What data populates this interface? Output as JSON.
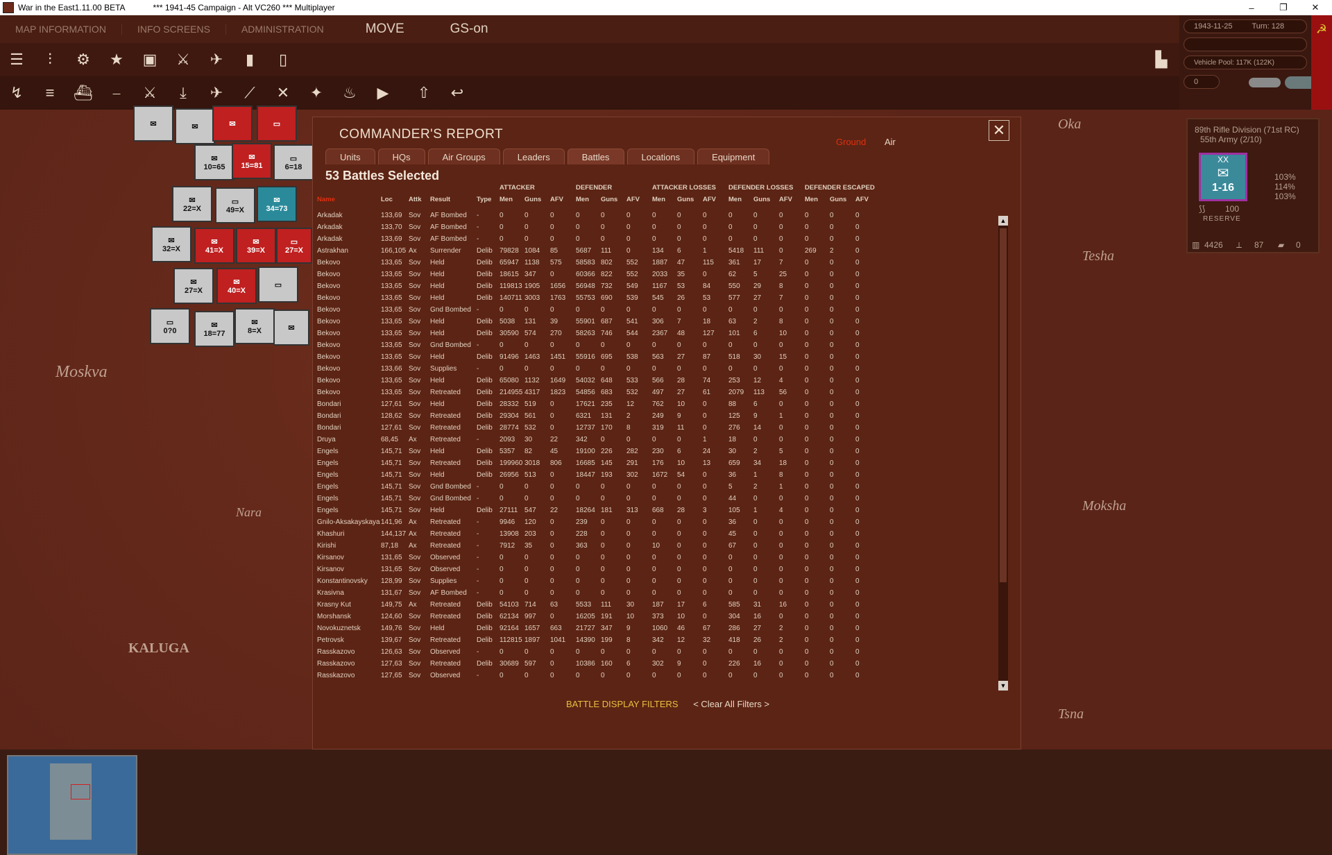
{
  "window": {
    "title_left": "War in the East1.11.00 BETA",
    "title_mid": "***   1941-45 Campaign - Alt VC260   ***   Multiplayer",
    "controls": [
      "–",
      "❐",
      "✕"
    ]
  },
  "menu": {
    "map_information": "MAP INFORMATION",
    "info_screens": "INFO SCREENS",
    "administration": "ADMINISTRATION",
    "move": "MOVE",
    "gs": "GS-on"
  },
  "status": {
    "date": "1943-11-25",
    "turn": "Turn: 128",
    "vehicle_pool": "Vehicle Pool: 117K (122K)",
    "field_value": "0"
  },
  "map": {
    "labels": [
      "Moskva",
      "KALUGA",
      "Oka",
      "Tesha",
      "Moksha",
      "Tsna",
      "Nara"
    ]
  },
  "counters": [
    "10=65",
    "15=81",
    "6=18",
    "22=X",
    "49=X",
    "34=73",
    "32=X",
    "41=X",
    "39=X",
    "27=X",
    "27=X",
    "40=X",
    "0?0",
    "18=77",
    "8=X"
  ],
  "unit_panel": {
    "name": "89th Rifle Division (71st RC)",
    "army": "55th Army (2/10)",
    "size": "XX",
    "strength": "1-16",
    "pct": [
      "103%",
      "114%",
      "103%"
    ],
    "morale": "100",
    "status": "RESERVE",
    "men": "4426",
    "guns": "87",
    "afv": "0"
  },
  "dialog": {
    "title": "COMMANDER'S REPORT",
    "toggle_ground": "Ground",
    "toggle_air": "Air",
    "close": "✕",
    "tabs": [
      "Units",
      "HQs",
      "Air Groups",
      "Leaders",
      "Battles",
      "Locations",
      "Equipment"
    ],
    "active_tab": 4,
    "subtitle": "53 Battles Selected",
    "group_headers": [
      "ATTACKER",
      "DEFENDER",
      "ATTACKER LOSSES",
      "DEFENDER LOSSES",
      "DEFENDER ESCAPED"
    ],
    "columns": [
      "Name",
      "Loc",
      "Attk",
      "Result",
      "Type",
      "Men",
      "Guns",
      "AFV",
      "Men",
      "Guns",
      "AFV",
      "Men",
      "Guns",
      "AFV",
      "Men",
      "Guns",
      "AFV",
      "Men",
      "Guns",
      "AFV"
    ],
    "rows": [
      [
        "Arkadak",
        "133,69",
        "Sov",
        "AF Bombed",
        "-",
        "0",
        "0",
        "0",
        "0",
        "0",
        "0",
        "0",
        "0",
        "0",
        "0",
        "0",
        "0",
        "0",
        "0",
        "0"
      ],
      [
        "Arkadak",
        "133,70",
        "Sov",
        "AF Bombed",
        "-",
        "0",
        "0",
        "0",
        "0",
        "0",
        "0",
        "0",
        "0",
        "0",
        "0",
        "0",
        "0",
        "0",
        "0",
        "0"
      ],
      [
        "Arkadak",
        "133,69",
        "Sov",
        "AF Bombed",
        "-",
        "0",
        "0",
        "0",
        "0",
        "0",
        "0",
        "0",
        "0",
        "0",
        "0",
        "0",
        "0",
        "0",
        "0",
        "0"
      ],
      [
        "Astrakhan",
        "166,105",
        "Ax",
        "Surrender",
        "Delib",
        "79828",
        "1084",
        "85",
        "5687",
        "111",
        "0",
        "134",
        "6",
        "1",
        "5418",
        "111",
        "0",
        "269",
        "2",
        "0"
      ],
      [
        "Bekovo",
        "133,65",
        "Sov",
        "Held",
        "Delib",
        "65947",
        "1138",
        "575",
        "58583",
        "802",
        "552",
        "1887",
        "47",
        "115",
        "361",
        "17",
        "7",
        "0",
        "0",
        "0"
      ],
      [
        "Bekovo",
        "133,65",
        "Sov",
        "Held",
        "Delib",
        "18615",
        "347",
        "0",
        "60366",
        "822",
        "552",
        "2033",
        "35",
        "0",
        "62",
        "5",
        "25",
        "0",
        "0",
        "0"
      ],
      [
        "Bekovo",
        "133,65",
        "Sov",
        "Held",
        "Delib",
        "119813",
        "1905",
        "1656",
        "56948",
        "732",
        "549",
        "1167",
        "53",
        "84",
        "550",
        "29",
        "8",
        "0",
        "0",
        "0"
      ],
      [
        "Bekovo",
        "133,65",
        "Sov",
        "Held",
        "Delib",
        "140711",
        "3003",
        "1763",
        "55753",
        "690",
        "539",
        "545",
        "26",
        "53",
        "577",
        "27",
        "7",
        "0",
        "0",
        "0"
      ],
      [
        "Bekovo",
        "133,65",
        "Sov",
        "Gnd Bombed",
        "-",
        "0",
        "0",
        "0",
        "0",
        "0",
        "0",
        "0",
        "0",
        "0",
        "0",
        "0",
        "0",
        "0",
        "0",
        "0"
      ],
      [
        "Bekovo",
        "133,65",
        "Sov",
        "Held",
        "Delib",
        "5038",
        "131",
        "39",
        "55901",
        "687",
        "541",
        "306",
        "7",
        "18",
        "63",
        "2",
        "8",
        "0",
        "0",
        "0"
      ],
      [
        "Bekovo",
        "133,65",
        "Sov",
        "Held",
        "Delib",
        "30590",
        "574",
        "270",
        "58263",
        "746",
        "544",
        "2367",
        "48",
        "127",
        "101",
        "6",
        "10",
        "0",
        "0",
        "0"
      ],
      [
        "Bekovo",
        "133,65",
        "Sov",
        "Gnd Bombed",
        "-",
        "0",
        "0",
        "0",
        "0",
        "0",
        "0",
        "0",
        "0",
        "0",
        "0",
        "0",
        "0",
        "0",
        "0",
        "0"
      ],
      [
        "Bekovo",
        "133,65",
        "Sov",
        "Held",
        "Delib",
        "91496",
        "1463",
        "1451",
        "55916",
        "695",
        "538",
        "563",
        "27",
        "87",
        "518",
        "30",
        "15",
        "0",
        "0",
        "0"
      ],
      [
        "Bekovo",
        "133,66",
        "Sov",
        "Supplies",
        "-",
        "0",
        "0",
        "0",
        "0",
        "0",
        "0",
        "0",
        "0",
        "0",
        "0",
        "0",
        "0",
        "0",
        "0",
        "0"
      ],
      [
        "Bekovo",
        "133,65",
        "Sov",
        "Held",
        "Delib",
        "65080",
        "1132",
        "1649",
        "54032",
        "648",
        "533",
        "566",
        "28",
        "74",
        "253",
        "12",
        "4",
        "0",
        "0",
        "0"
      ],
      [
        "Bekovo",
        "133,65",
        "Sov",
        "Retreated",
        "Delib",
        "214955",
        "4317",
        "1823",
        "54856",
        "683",
        "532",
        "497",
        "27",
        "61",
        "2079",
        "113",
        "56",
        "0",
        "0",
        "0"
      ],
      [
        "Bondari",
        "127,61",
        "Sov",
        "Held",
        "Delib",
        "28332",
        "519",
        "0",
        "17621",
        "235",
        "12",
        "762",
        "10",
        "0",
        "88",
        "6",
        "0",
        "0",
        "0",
        "0"
      ],
      [
        "Bondari",
        "128,62",
        "Sov",
        "Retreated",
        "Delib",
        "29304",
        "561",
        "0",
        "6321",
        "131",
        "2",
        "249",
        "9",
        "0",
        "125",
        "9",
        "1",
        "0",
        "0",
        "0"
      ],
      [
        "Bondari",
        "127,61",
        "Sov",
        "Retreated",
        "Delib",
        "28774",
        "532",
        "0",
        "12737",
        "170",
        "8",
        "319",
        "11",
        "0",
        "276",
        "14",
        "0",
        "0",
        "0",
        "0"
      ],
      [
        "Druya",
        "68,45",
        "Ax",
        "Retreated",
        "-",
        "2093",
        "30",
        "22",
        "342",
        "0",
        "0",
        "0",
        "0",
        "1",
        "18",
        "0",
        "0",
        "0",
        "0",
        "0"
      ],
      [
        "Engels",
        "145,71",
        "Sov",
        "Held",
        "Delib",
        "5357",
        "82",
        "45",
        "19100",
        "226",
        "282",
        "230",
        "6",
        "24",
        "30",
        "2",
        "5",
        "0",
        "0",
        "0"
      ],
      [
        "Engels",
        "145,71",
        "Sov",
        "Retreated",
        "Delib",
        "199960",
        "3018",
        "806",
        "16685",
        "145",
        "291",
        "176",
        "10",
        "13",
        "659",
        "34",
        "18",
        "0",
        "0",
        "0"
      ],
      [
        "Engels",
        "145,71",
        "Sov",
        "Held",
        "Delib",
        "26956",
        "513",
        "0",
        "18447",
        "193",
        "302",
        "1672",
        "54",
        "0",
        "36",
        "1",
        "8",
        "0",
        "0",
        "0"
      ],
      [
        "Engels",
        "145,71",
        "Sov",
        "Gnd Bombed",
        "-",
        "0",
        "0",
        "0",
        "0",
        "0",
        "0",
        "0",
        "0",
        "0",
        "5",
        "2",
        "1",
        "0",
        "0",
        "0"
      ],
      [
        "Engels",
        "145,71",
        "Sov",
        "Gnd Bombed",
        "-",
        "0",
        "0",
        "0",
        "0",
        "0",
        "0",
        "0",
        "0",
        "0",
        "44",
        "0",
        "0",
        "0",
        "0",
        "0"
      ],
      [
        "Engels",
        "145,71",
        "Sov",
        "Held",
        "Delib",
        "27111",
        "547",
        "22",
        "18264",
        "181",
        "313",
        "668",
        "28",
        "3",
        "105",
        "1",
        "4",
        "0",
        "0",
        "0"
      ],
      [
        "Gnilo-Aksakayskaya",
        "141,96",
        "Ax",
        "Retreated",
        "-",
        "9946",
        "120",
        "0",
        "239",
        "0",
        "0",
        "0",
        "0",
        "0",
        "36",
        "0",
        "0",
        "0",
        "0",
        "0"
      ],
      [
        "Khashuri",
        "144,137",
        "Ax",
        "Retreated",
        "-",
        "13908",
        "203",
        "0",
        "228",
        "0",
        "0",
        "0",
        "0",
        "0",
        "45",
        "0",
        "0",
        "0",
        "0",
        "0"
      ],
      [
        "Kirishi",
        "87,18",
        "Ax",
        "Retreated",
        "-",
        "7912",
        "35",
        "0",
        "363",
        "0",
        "0",
        "10",
        "0",
        "0",
        "67",
        "0",
        "0",
        "0",
        "0",
        "0"
      ],
      [
        "Kirsanov",
        "131,65",
        "Sov",
        "Observed",
        "-",
        "0",
        "0",
        "0",
        "0",
        "0",
        "0",
        "0",
        "0",
        "0",
        "0",
        "0",
        "0",
        "0",
        "0",
        "0"
      ],
      [
        "Kirsanov",
        "131,65",
        "Sov",
        "Observed",
        "-",
        "0",
        "0",
        "0",
        "0",
        "0",
        "0",
        "0",
        "0",
        "0",
        "0",
        "0",
        "0",
        "0",
        "0",
        "0"
      ],
      [
        "Konstantinovsky",
        "128,99",
        "Sov",
        "Supplies",
        "-",
        "0",
        "0",
        "0",
        "0",
        "0",
        "0",
        "0",
        "0",
        "0",
        "0",
        "0",
        "0",
        "0",
        "0",
        "0"
      ],
      [
        "Krasivna",
        "131,67",
        "Sov",
        "AF Bombed",
        "-",
        "0",
        "0",
        "0",
        "0",
        "0",
        "0",
        "0",
        "0",
        "0",
        "0",
        "0",
        "0",
        "0",
        "0",
        "0"
      ],
      [
        "Krasny Kut",
        "149,75",
        "Ax",
        "Retreated",
        "Delib",
        "54103",
        "714",
        "63",
        "5533",
        "111",
        "30",
        "187",
        "17",
        "6",
        "585",
        "31",
        "16",
        "0",
        "0",
        "0"
      ],
      [
        "Morshansk",
        "124,60",
        "Sov",
        "Retreated",
        "Delib",
        "62134",
        "997",
        "0",
        "16205",
        "191",
        "10",
        "373",
        "10",
        "0",
        "304",
        "16",
        "0",
        "0",
        "0",
        "0"
      ],
      [
        "Novokuznetsk",
        "149,76",
        "Sov",
        "Held",
        "Delib",
        "92164",
        "1657",
        "663",
        "21727",
        "347",
        "9",
        "1060",
        "46",
        "67",
        "286",
        "27",
        "2",
        "0",
        "0",
        "0"
      ],
      [
        "Petrovsk",
        "139,67",
        "Sov",
        "Retreated",
        "Delib",
        "112815",
        "1897",
        "1041",
        "14390",
        "199",
        "8",
        "342",
        "12",
        "32",
        "418",
        "26",
        "2",
        "0",
        "0",
        "0"
      ],
      [
        "Rasskazovo",
        "126,63",
        "Sov",
        "Observed",
        "-",
        "0",
        "0",
        "0",
        "0",
        "0",
        "0",
        "0",
        "0",
        "0",
        "0",
        "0",
        "0",
        "0",
        "0",
        "0"
      ],
      [
        "Rasskazovo",
        "127,63",
        "Sov",
        "Retreated",
        "Delib",
        "30689",
        "597",
        "0",
        "10386",
        "160",
        "6",
        "302",
        "9",
        "0",
        "226",
        "16",
        "0",
        "0",
        "0",
        "0"
      ],
      [
        "Rasskazovo",
        "127,65",
        "Sov",
        "Observed",
        "-",
        "0",
        "0",
        "0",
        "0",
        "0",
        "0",
        "0",
        "0",
        "0",
        "0",
        "0",
        "0",
        "0",
        "0",
        "0"
      ]
    ],
    "filters_label": "BATTLE DISPLAY FILTERS",
    "clear_filters": "< Clear All Filters >"
  },
  "colors": {
    "dialog_bg": "#5c2414",
    "toggle_ground_active": "#e03010",
    "filters_label": "#e8c040"
  }
}
